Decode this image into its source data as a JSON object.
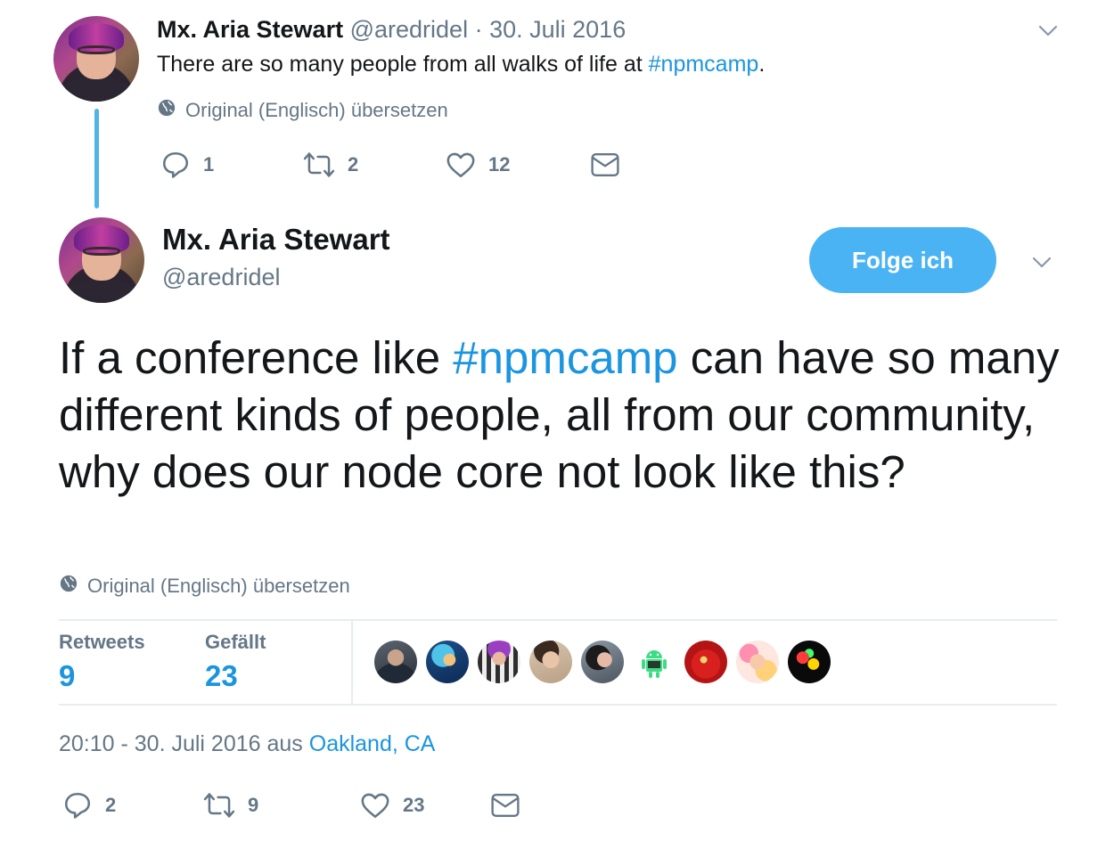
{
  "parent_tweet": {
    "name": "Mx. Aria Stewart",
    "handle": "@aredridel",
    "separator": "·",
    "date": "30. Juli 2016",
    "text_before": "There are so many people from all walks of life at ",
    "hashtag": "#npmcamp",
    "text_after": ".",
    "translate_label": "Original (Englisch) übersetzen",
    "reply_count": "1",
    "retweet_count": "2",
    "like_count": "12",
    "icons": [
      "globe-icon",
      "chevron-down-icon",
      "reply-icon",
      "retweet-icon",
      "heart-icon",
      "mail-icon"
    ]
  },
  "main_tweet": {
    "name": "Mx. Aria Stewart",
    "handle": "@aredridel",
    "follow_label": "Folge ich",
    "text_before": "If a conference like ",
    "hashtag": "#npmcamp",
    "text_after": " can have so many different kinds of people, all from our community, why does our node core not look like this?",
    "translate_label": "Original (Englisch) übersetzen",
    "stats": {
      "retweets_label": "Retweets",
      "retweets_value": "9",
      "likes_label": "Gefällt",
      "likes_value": "23"
    },
    "timestamp": "20:10 - 30. Juli 2016 aus ",
    "location": "Oakland, CA",
    "reply_count": "2",
    "retweet_count": "9",
    "like_count": "23"
  },
  "colors": {
    "link": "#1b95e0",
    "muted": "#657786",
    "follow_button": "#4ab3f4",
    "thread_line": "#4fb5e6",
    "divider": "#e6ecf0"
  }
}
